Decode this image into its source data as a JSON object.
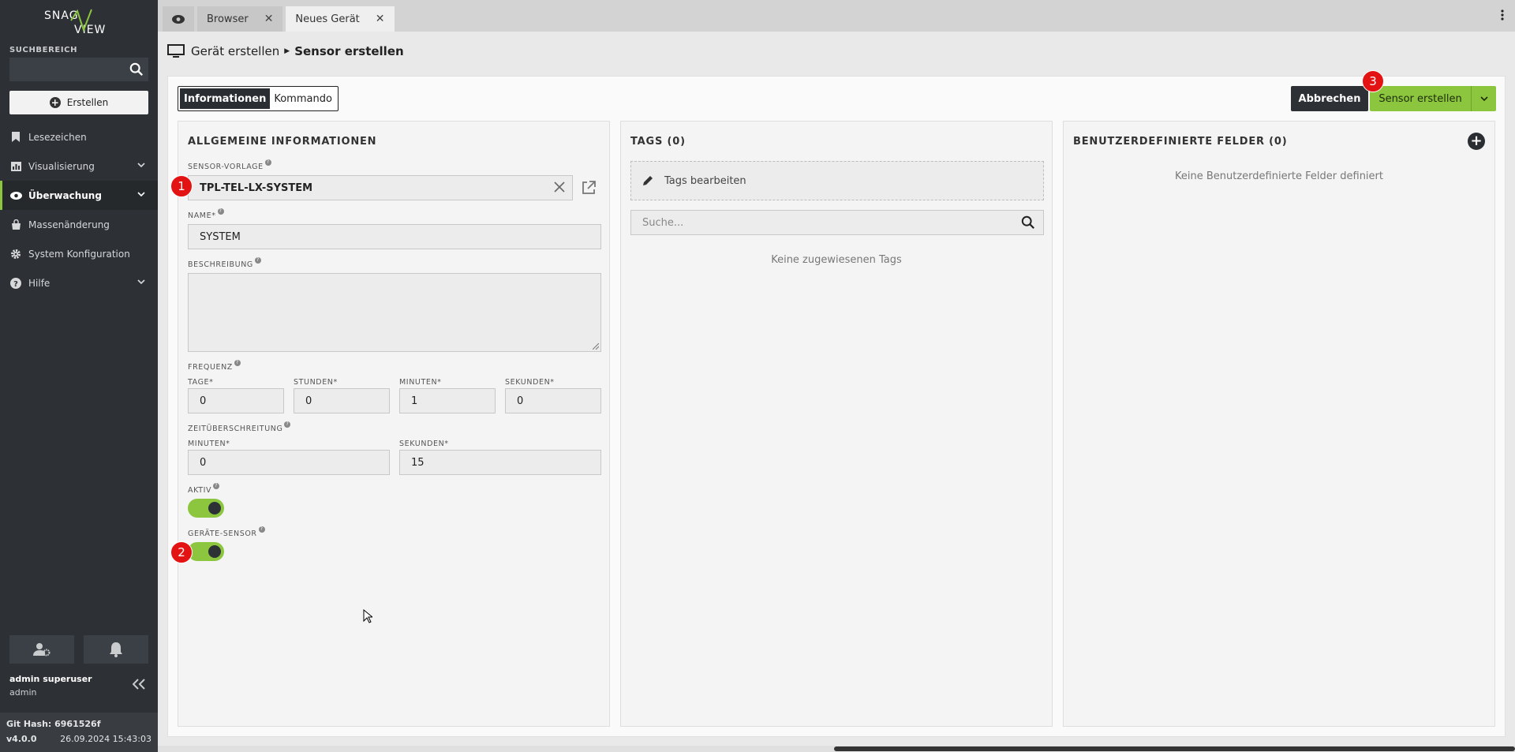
{
  "sidebar": {
    "logo_top": "SNAG",
    "logo_bottom": "VIEW",
    "search_label": "SUCHBEREICH",
    "create_label": "Erstellen",
    "items": [
      {
        "label": "Lesezeichen",
        "icon": "bookmark-icon"
      },
      {
        "label": "Visualisierung",
        "icon": "chart-icon"
      },
      {
        "label": "Überwachung",
        "icon": "eye-icon"
      },
      {
        "label": "Massenänderung",
        "icon": "bag-icon"
      },
      {
        "label": "System Konfiguration",
        "icon": "gear-icon"
      },
      {
        "label": "Hilfe",
        "icon": "help-icon"
      }
    ],
    "user_name": "admin superuser",
    "user_login": "admin",
    "git_hash": "Git Hash: 6961526f",
    "version": "v4.0.0",
    "build_date": "26.09.2024 15:43:03"
  },
  "tabs": [
    {
      "label": "Browser"
    },
    {
      "label": "Neues Gerät"
    }
  ],
  "breadcrumb": {
    "parent": "Gerät erstellen",
    "current": "Sensor erstellen"
  },
  "toolbar": {
    "seg_info": "Informationen",
    "seg_cmd": "Kommando",
    "cancel": "Abbrechen",
    "create": "Sensor erstellen"
  },
  "general": {
    "title": "ALLGEMEINE INFORMATIONEN",
    "template_label": "SENSOR-VORLAGE",
    "template_value": "TPL-TEL-LX-SYSTEM",
    "name_label": "NAME*",
    "name_value": "SYSTEM",
    "desc_label": "BESCHREIBUNG",
    "freq_label": "FREQUENZ",
    "days_label": "TAGE*",
    "days_value": "0",
    "hours_label": "STUNDEN*",
    "hours_value": "0",
    "minutes_label": "MINUTEN*",
    "minutes_value": "1",
    "seconds_label": "SEKUNDEN*",
    "seconds_value": "0",
    "timeout_label": "ZEITÜBERSCHREITUNG",
    "t_minutes_label": "MINUTEN*",
    "t_minutes_value": "0",
    "t_seconds_label": "SEKUNDEN*",
    "t_seconds_value": "15",
    "active_label": "AKTIV",
    "device_sensor_label": "GERÄTE-SENSOR"
  },
  "tags": {
    "title": "TAGS (0)",
    "edit": "Tags bearbeiten",
    "search_placeholder": "Suche...",
    "empty": "Keine zugewiesenen Tags"
  },
  "custom": {
    "title": "BENUTZERDEFINIERTE FELDER (0)",
    "empty": "Keine Benutzerdefinierte Felder definiert"
  },
  "badges": [
    "1",
    "2",
    "3"
  ],
  "colors": {
    "accent": "#8cc63f",
    "sidebar": "#2d3135",
    "badge": "#e41313"
  }
}
